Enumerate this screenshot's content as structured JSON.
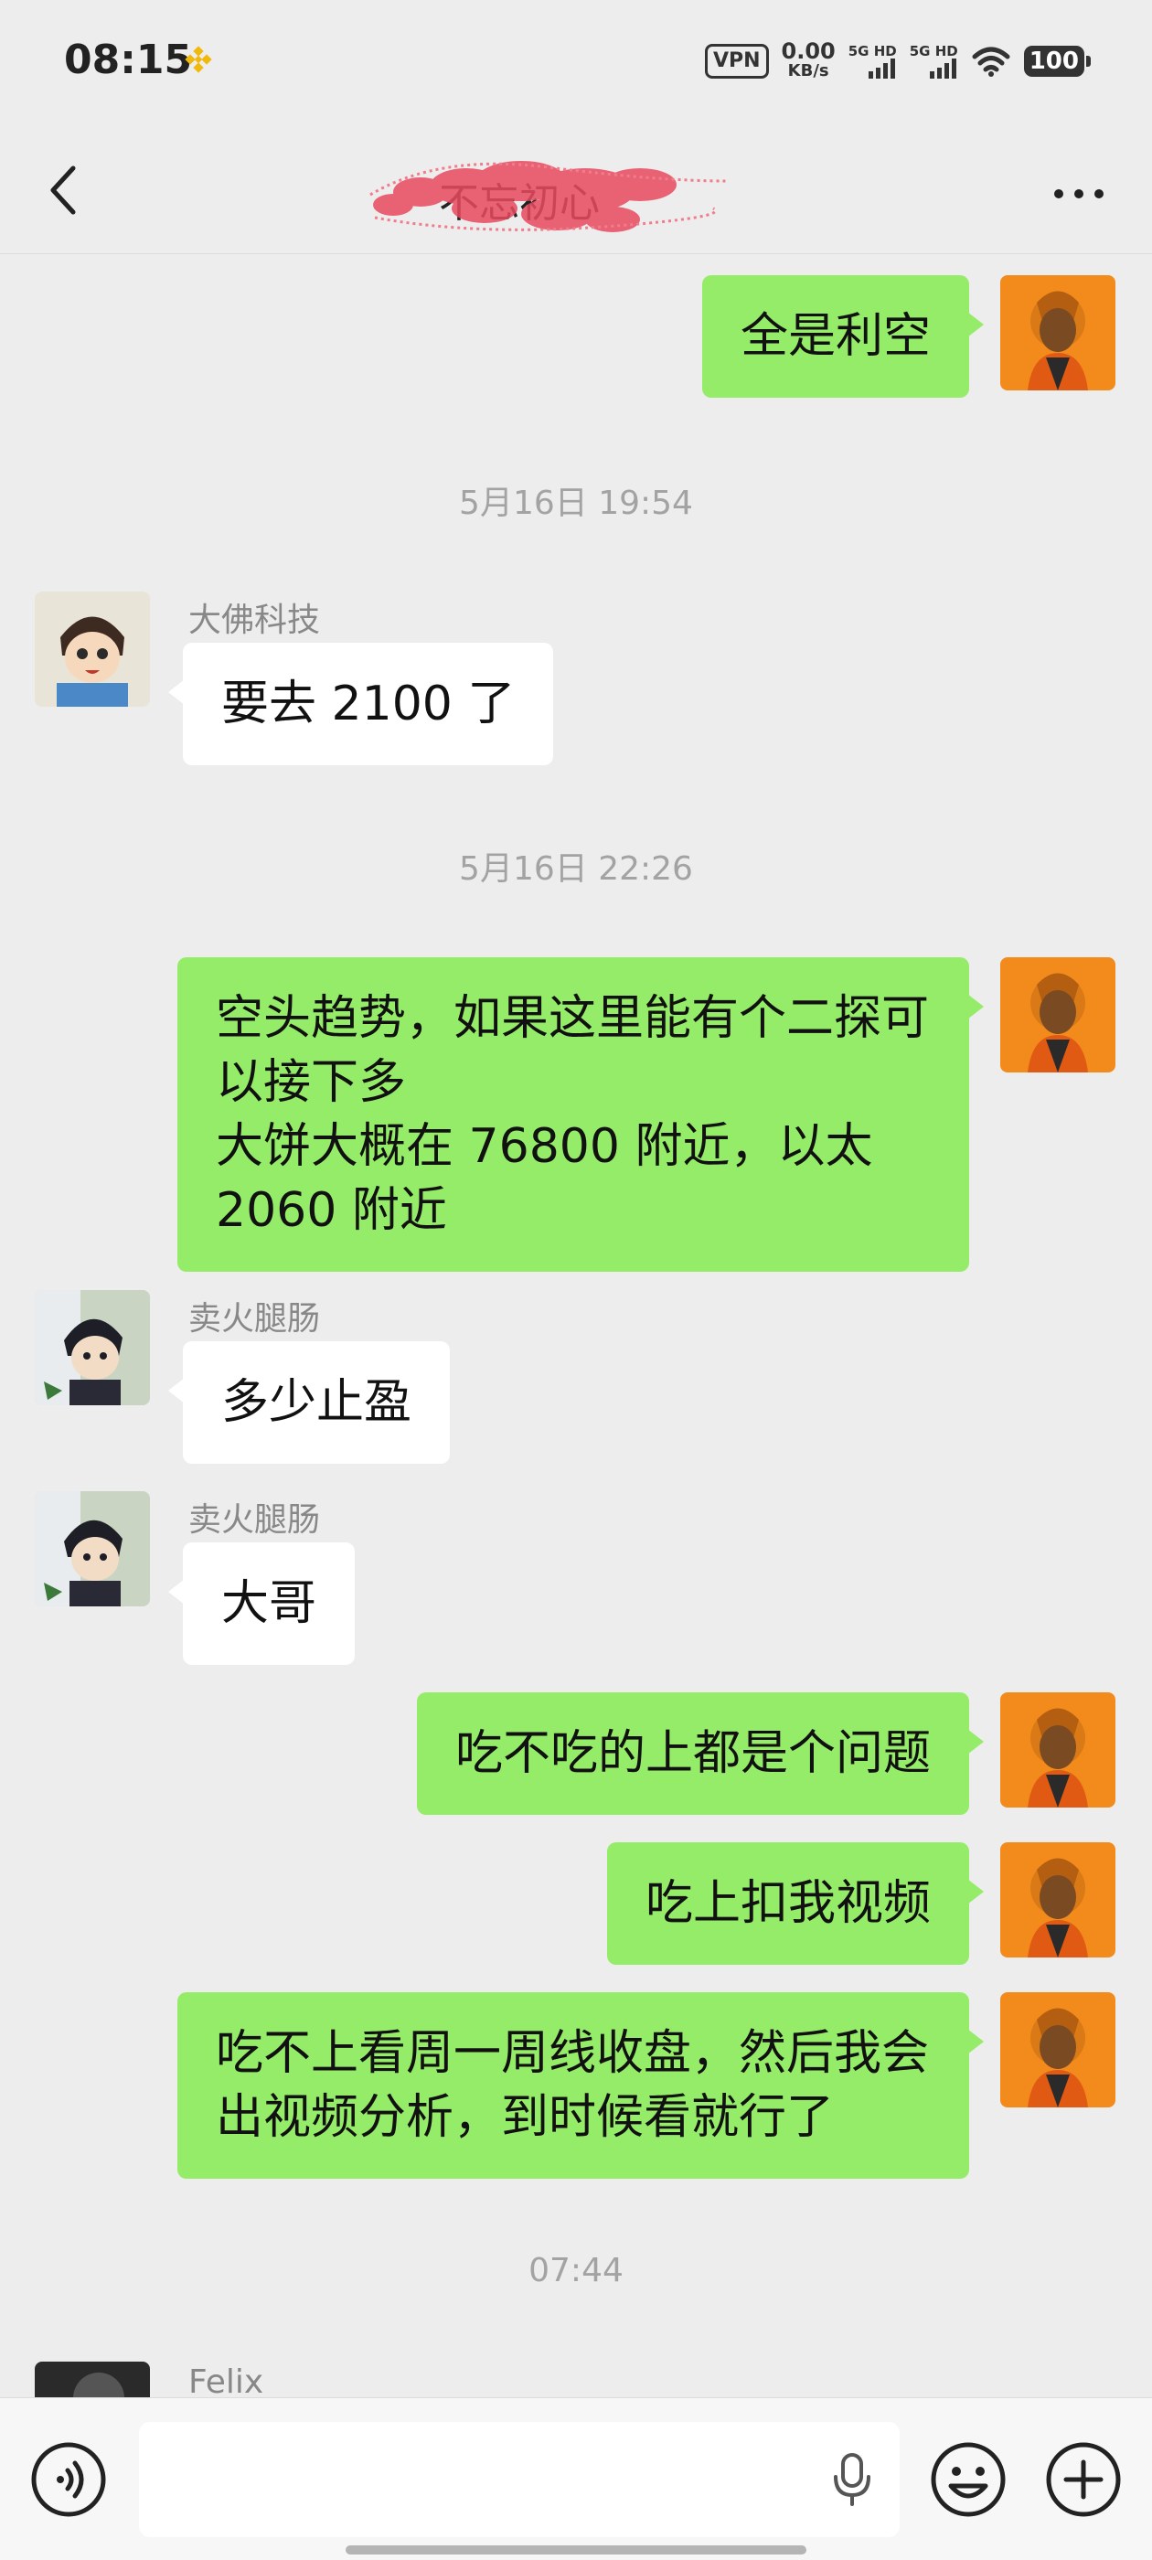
{
  "status_bar": {
    "time": "08:15",
    "vpn": "VPN",
    "net_speed_value": "0.00",
    "net_speed_unit": "KB/s",
    "signal1": "5G HD",
    "signal2": "5G HD",
    "battery": "100"
  },
  "nav": {
    "title": "不忘初心"
  },
  "messages": [
    {
      "type": "out",
      "text": "全是利空"
    },
    {
      "type": "time",
      "text": "5月16日 19:54"
    },
    {
      "type": "in",
      "sender": "大佛科技",
      "text": "要去 2100 了"
    },
    {
      "type": "time",
      "text": "5月16日 22:26"
    },
    {
      "type": "out",
      "text": "空头趋势，如果这里能有个二探可以接下多\n大饼大概在 76800 附近，以太 2060 附近"
    },
    {
      "type": "in",
      "sender": "卖火腿肠",
      "text": "多少止盈"
    },
    {
      "type": "in",
      "sender": "卖火腿肠",
      "text": "大哥"
    },
    {
      "type": "out",
      "text": "吃不吃的上都是个问题"
    },
    {
      "type": "out",
      "text": "吃上扣我视频"
    },
    {
      "type": "out",
      "text": "吃不上看周一周线收盘，然后我会出视频分析，到时候看就行了"
    },
    {
      "type": "time",
      "text": "07:44"
    },
    {
      "type": "in",
      "sender": "Felix",
      "text": ""
    }
  ],
  "icons": {
    "back": "chevron-left-icon",
    "more": "more-dots-icon",
    "voice": "voice-icon",
    "mic": "mic-icon",
    "emoji": "emoji-icon",
    "plus": "plus-icon"
  },
  "colors": {
    "bubble_out": "#95ec69",
    "bubble_in": "#ffffff",
    "background": "#ededed"
  }
}
